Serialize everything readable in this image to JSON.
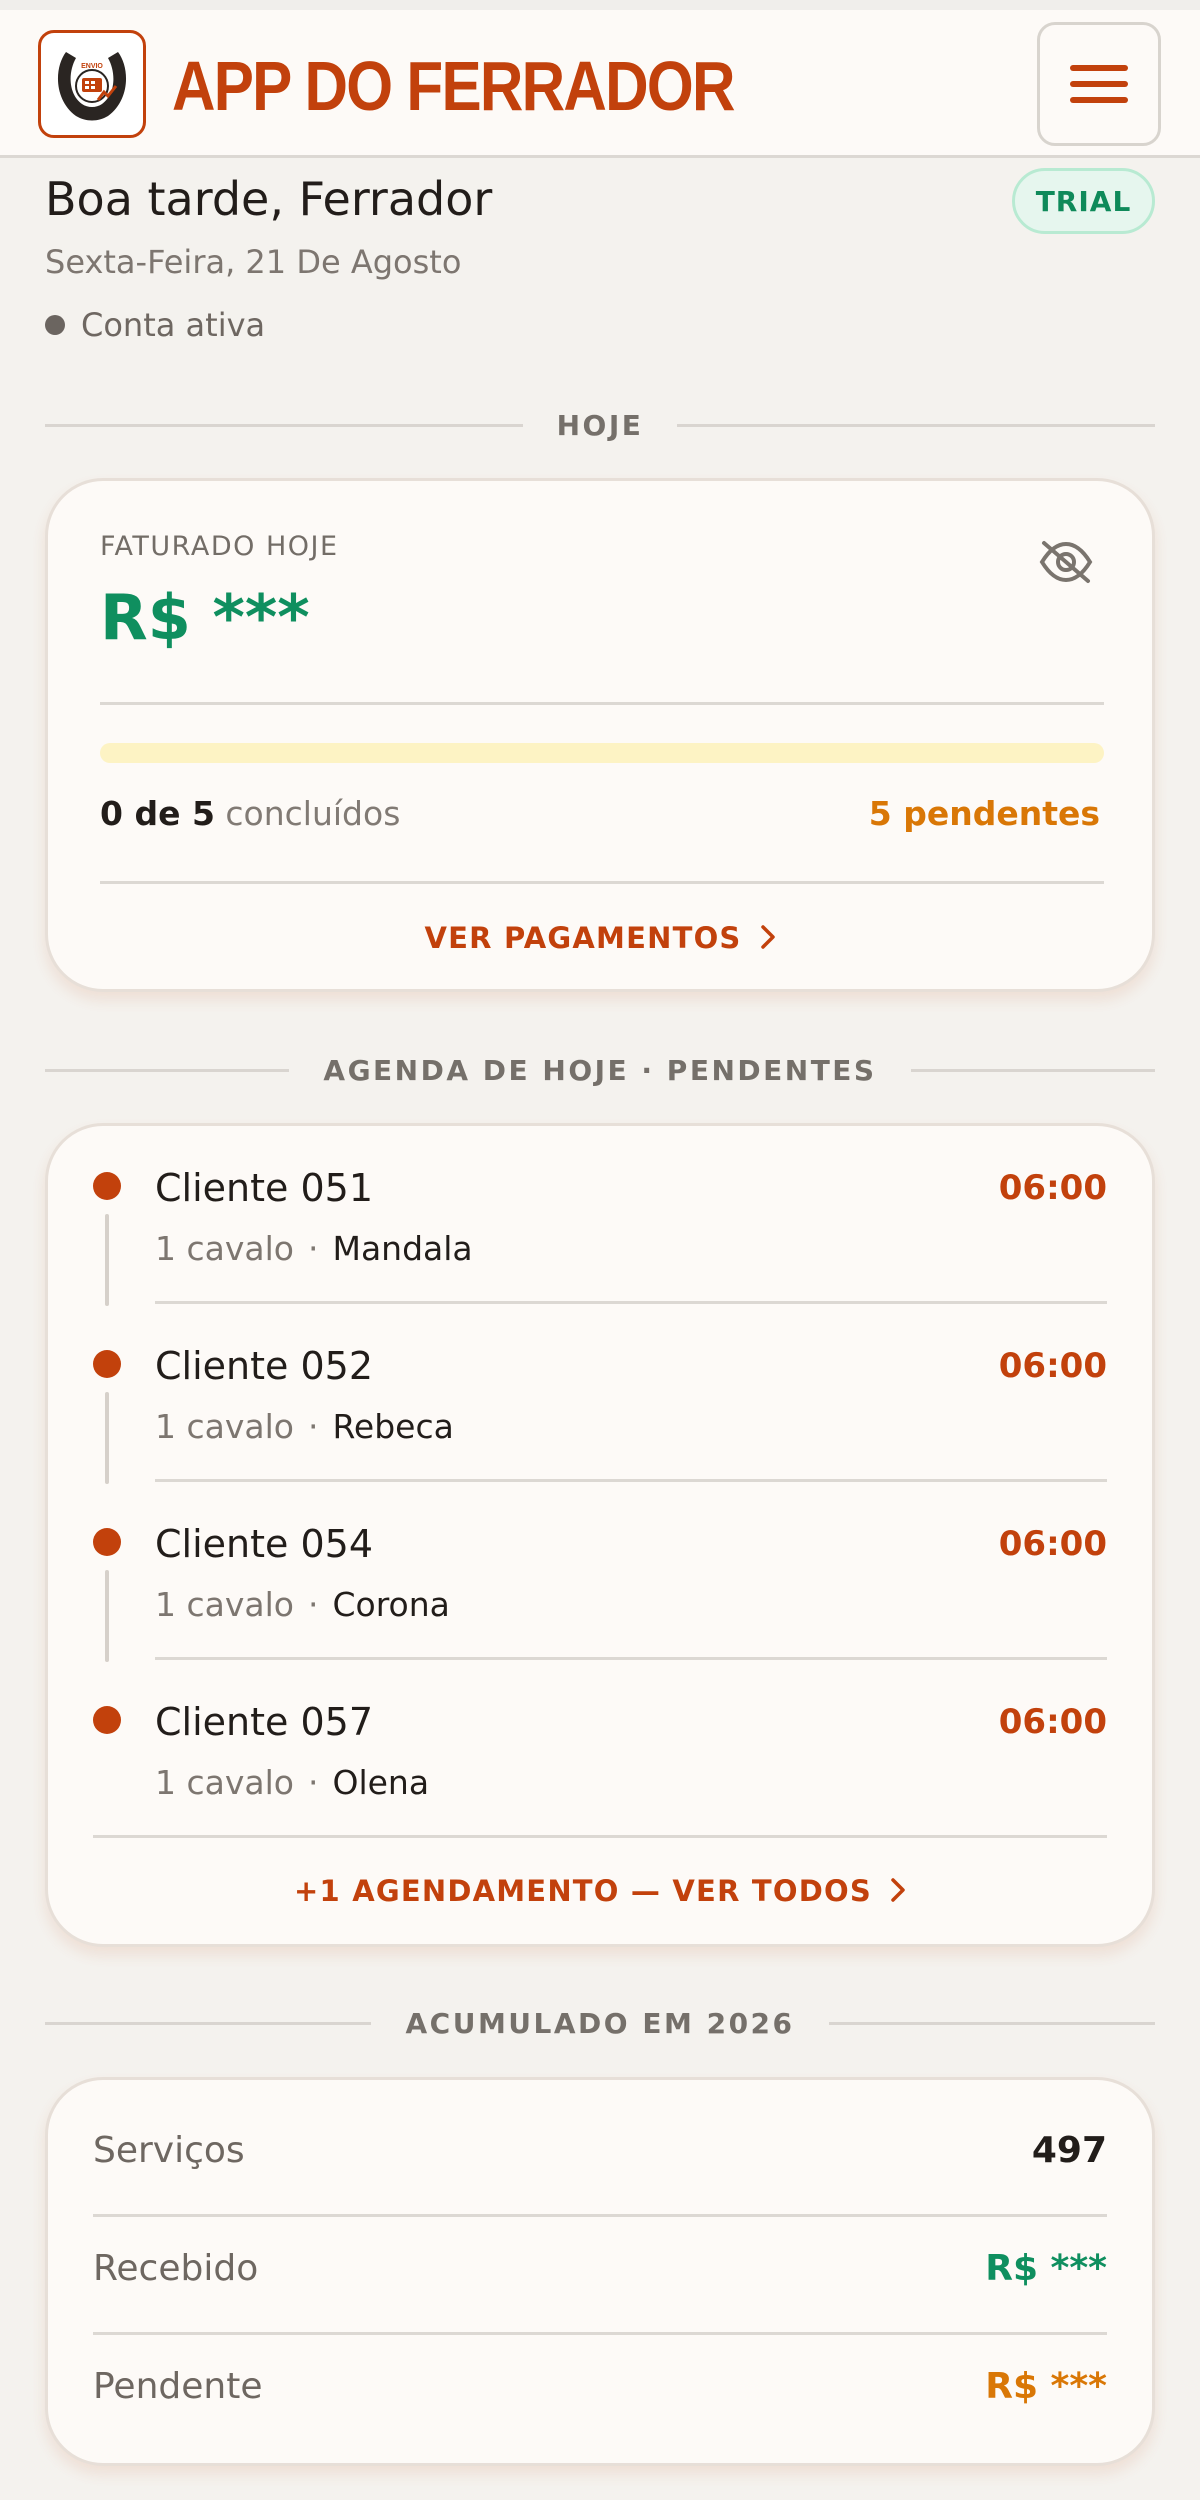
{
  "header": {
    "app_title": "APP DO FERRADOR",
    "logo_icon": "horseshoe-logo",
    "menu_icon": "hamburger-menu-icon",
    "accent_color": "#c2410c"
  },
  "greeting": {
    "title": "Boa tarde, Ferrador",
    "date": "Sexta-Feira, 21 De Agosto",
    "status": "Conta ativa",
    "badge": "TRIAL"
  },
  "today": {
    "section_label": "HOJE",
    "billed_label": "FATURADO HOJE",
    "billed_value": "R$ ***",
    "visibility_icon": "eye-off-icon",
    "progress_done": "0 de 5",
    "progress_suffix": "concluídos",
    "progress_fraction": 0,
    "pending_text": "5 pendentes",
    "action": "VER PAGAMENTOS"
  },
  "agenda": {
    "section_label": "AGENDA DE HOJE · PENDENTES",
    "items": [
      {
        "client": "Cliente 051",
        "time": "06:00",
        "horses": "1 cavalo",
        "sep": "·",
        "horse_name": "Mandala"
      },
      {
        "client": "Cliente 052",
        "time": "06:00",
        "horses": "1 cavalo",
        "sep": "·",
        "horse_name": "Rebeca"
      },
      {
        "client": "Cliente 054",
        "time": "06:00",
        "horses": "1 cavalo",
        "sep": "·",
        "horse_name": "Corona"
      },
      {
        "client": "Cliente 057",
        "time": "06:00",
        "horses": "1 cavalo",
        "sep": "·",
        "horse_name": "Olena"
      }
    ],
    "more_action": "+1 AGENDAMENTO — VER TODOS"
  },
  "accumulated": {
    "section_label": "ACUMULADO EM 2026",
    "rows": [
      {
        "label": "Serviços",
        "value": "497",
        "color": "#221d1a"
      },
      {
        "label": "Recebido",
        "value": "R$ ***",
        "color": "#0f8f5f"
      },
      {
        "label": "Pendente",
        "value": "R$ ***",
        "color": "#d97706"
      }
    ]
  }
}
